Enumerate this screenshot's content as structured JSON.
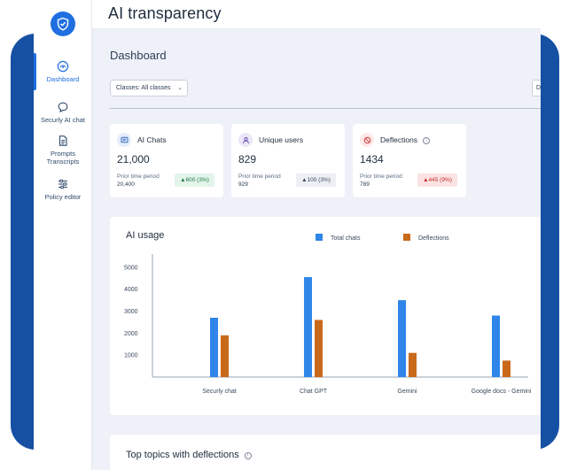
{
  "app": {
    "title": "AI transparency"
  },
  "sidebar": {
    "items": [
      {
        "label": "Dashboard",
        "icon": "dashboard-icon",
        "active": true
      },
      {
        "label": "Securly AI chat",
        "icon": "chat-bubble-icon"
      },
      {
        "label": "Prompts Transcripts",
        "icon": "document-icon"
      },
      {
        "label": "Policy editor",
        "icon": "sliders-icon"
      }
    ]
  },
  "dashboard": {
    "title": "Dashboard",
    "classes_filter": "Classes: All classes",
    "right_filter": "D"
  },
  "cards": [
    {
      "title": "AI Chats",
      "value": "21,000",
      "prior_label": "Prior time period",
      "prior_value": "20,400",
      "badge": "▲600 (3%)",
      "badge_bg": "#e3f4ea",
      "badge_color": "#1e7a45",
      "icon": "chat-card-icon",
      "icon_bg": "#e4edfb",
      "icon_color": "#2c5fb5"
    },
    {
      "title": "Unique users",
      "value": "829",
      "prior_label": "Prior time period",
      "prior_value": "929",
      "badge": "▲100 (3%)",
      "badge_bg": "#eceff3",
      "badge_color": "#3a4a5f",
      "icon": "user-icon",
      "icon_bg": "#ebe7f7",
      "icon_color": "#5a4aa8"
    },
    {
      "title": "Deflections",
      "value": "1434",
      "prior_label": "Prior time period",
      "prior_value": "789",
      "badge": "▲445 (9%)",
      "badge_bg": "#fbe3e3",
      "badge_color": "#c0292b",
      "icon": "prohibited-icon",
      "icon_bg": "#fde8e8",
      "icon_color": "#d23434"
    }
  ],
  "chart_data": {
    "type": "bar",
    "title": "AI usage",
    "categories": [
      "Securly chat",
      "Chat GPT",
      "Gemini",
      "Google docs - Gemini"
    ],
    "series": [
      {
        "name": "Total chats",
        "values": [
          2700,
          4550,
          3500,
          2800
        ],
        "color": "#2f86e8"
      },
      {
        "name": "Deflections",
        "values": [
          1900,
          2600,
          1100,
          750
        ],
        "color": "#c9691a"
      }
    ],
    "yticks": [
      1000,
      2000,
      3000,
      4000,
      5000
    ],
    "ylim": [
      0,
      5600
    ],
    "xlabel": "",
    "ylabel": "",
    "legend": "top"
  },
  "topics": {
    "title": "Top topics with deflections"
  }
}
